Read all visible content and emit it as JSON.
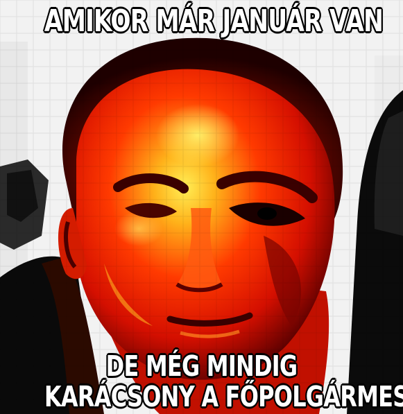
{
  "meme": {
    "top_text": "AMIKOR MÁR JANUÁR VAN",
    "bottom_text_line1": "DE MÉG MINDIG",
    "bottom_text_line2": "KARÁCSONY A FŐPOLGÁRMESTER"
  },
  "colors": {
    "caption_fill": "#ffffff",
    "caption_outline": "#000000",
    "face_hot": "#ff2a00",
    "face_highlight": "#ffe640",
    "face_shadow": "#3a0000",
    "background": "#f4f4f4"
  }
}
